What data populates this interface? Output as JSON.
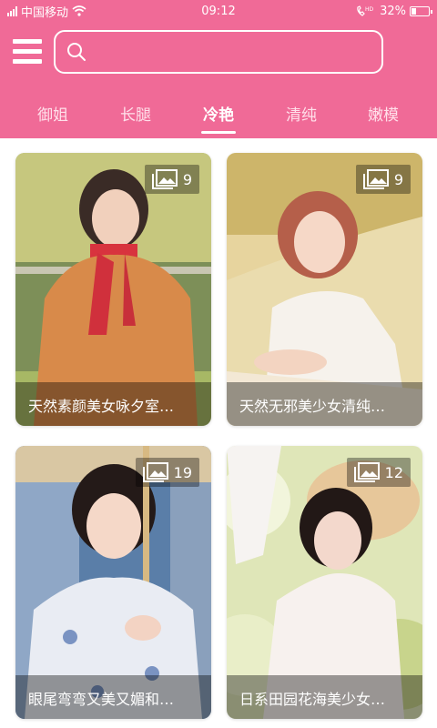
{
  "status": {
    "carrier": "中国移动",
    "time": "09:12",
    "volte": "HD",
    "battery": "32%",
    "battery_level": 0.32
  },
  "header": {
    "search_placeholder": "",
    "tabs": [
      {
        "label": "御姐",
        "active": false
      },
      {
        "label": "长腿",
        "active": false
      },
      {
        "label": "冷艳",
        "active": true
      },
      {
        "label": "清纯",
        "active": false
      },
      {
        "label": "嫩模",
        "active": false
      }
    ]
  },
  "colors": {
    "brand": "#f06a97",
    "caption_bg": "rgba(0,0,0,0.38)"
  },
  "cards": [
    {
      "title": "天然素颜美女咏夕室…",
      "count": "9"
    },
    {
      "title": "天然无邪美少女清纯…",
      "count": "9"
    },
    {
      "title": "眼尾弯弯又美又媚和…",
      "count": "19"
    },
    {
      "title": "日系田园花海美少女…",
      "count": "12"
    }
  ]
}
